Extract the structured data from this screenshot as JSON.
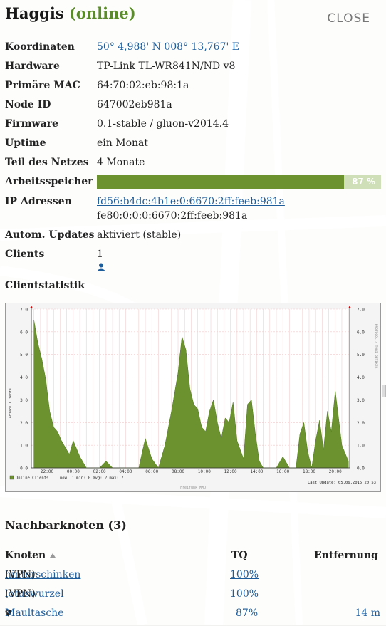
{
  "node": {
    "name": "Haggis",
    "status": "(online)"
  },
  "close_label": "CLOSE",
  "info": {
    "coords_label": "Koordinaten",
    "coords_value": "50° 4,988' N 008° 13,767' E",
    "hardware_label": "Hardware",
    "hardware_value": "TP-Link TL-WR841N/ND v8",
    "mac_label": "Primäre MAC",
    "mac_value": "64:70:02:eb:98:1a",
    "nodeid_label": "Node ID",
    "nodeid_value": "647002eb981a",
    "firmware_label": "Firmware",
    "firmware_value": "0.1-stable / gluon-v2014.4",
    "uptime_label": "Uptime",
    "uptime_value": "ein Monat",
    "network_label": "Teil des Netzes",
    "network_value": "4 Monate",
    "memory_label": "Arbeitsspeicher",
    "memory_percent": 87,
    "memory_text": "87 %",
    "ip_label": "IP Adressen",
    "ip_1": "fd56:b4dc:4b1e:0:6670:2ff:feeb:981a",
    "ip_2": "fe80:0:0:0:6670:2ff:feeb:981a",
    "autoupdate_label": "Autom. Updates",
    "autoupdate_value": "aktiviert (stable)",
    "clients_label": "Clients",
    "clients_value": "1",
    "clientstats_label": "Clientstatistik"
  },
  "chart_data": {
    "type": "area",
    "xlabel": "",
    "ylabel": "Anzahl Clients",
    "y2label": "PROTOCOL / TOBI OETIKER",
    "ylim": [
      0,
      7
    ],
    "yticks": [
      "0.0",
      "1.0",
      "2.0",
      "3.0",
      "4.0",
      "5.0",
      "6.0",
      "7.0"
    ],
    "xticks": [
      "22:00",
      "00:00",
      "02:00",
      "04:00",
      "06:00",
      "08:00",
      "10:00",
      "12:00",
      "14:00",
      "16:00",
      "18:00",
      "20:00"
    ],
    "series_name": "Online Clients",
    "legend_stats": "now:    1   min:    0   avg:    2   max:    7",
    "last_update": "Last Update:  05.06.2015 20:53",
    "footer": "Freifunk MMU",
    "color": "#6b922e",
    "x": [
      21.0,
      21.3,
      21.6,
      21.9,
      22.2,
      22.5,
      22.8,
      23.1,
      23.4,
      23.7,
      24.0,
      24.5,
      25.0,
      25.5,
      26.0,
      26.5,
      27.0,
      27.5,
      28.0,
      28.5,
      29.0,
      29.5,
      30.0,
      30.5,
      31.0,
      31.5,
      32.0,
      32.3,
      32.6,
      32.9,
      33.2,
      33.5,
      33.8,
      34.1,
      34.4,
      34.7,
      35.0,
      35.3,
      35.6,
      35.9,
      36.2,
      36.5,
      37.0,
      37.3,
      37.6,
      37.9,
      38.2,
      38.5,
      39.0,
      39.5,
      40.0,
      40.5,
      41.0,
      41.3,
      41.6,
      41.9,
      42.2,
      42.5,
      42.8,
      43.1,
      43.4,
      43.7,
      44.0,
      44.5,
      45.0
    ],
    "values": [
      6.5,
      5.5,
      4.8,
      3.9,
      2.5,
      1.8,
      1.6,
      1.2,
      0.9,
      0.6,
      1.2,
      0.5,
      0,
      0,
      0,
      0.3,
      0,
      0,
      0,
      0,
      0,
      1.3,
      0.4,
      0,
      1.0,
      2.5,
      4.2,
      5.8,
      5.2,
      3.5,
      2.8,
      2.6,
      1.8,
      1.6,
      2.5,
      3.0,
      2.0,
      1.3,
      2.2,
      2.0,
      2.9,
      1.2,
      0.4,
      2.8,
      3.0,
      1.5,
      0.3,
      0,
      0,
      0,
      0.5,
      0,
      0,
      1.5,
      2.0,
      0.7,
      0,
      1.2,
      2.1,
      0.8,
      2.5,
      1.6,
      3.4,
      1.0,
      0.3
    ]
  },
  "neighbours": {
    "title": "Nachbarknoten (3)",
    "col_node": "Knoten",
    "col_tq": "TQ",
    "col_dist": "Entfernung",
    "rows": [
      {
        "name": "hinterschinken",
        "suffix": "(VPN)",
        "tq": "100%",
        "dist": ""
      },
      {
        "name": "lotuswurzel",
        "suffix": "(VPN)",
        "tq": "100%",
        "dist": ""
      },
      {
        "name": "Maultasche",
        "suffix": "",
        "tq": "87%",
        "dist": "14 m"
      }
    ]
  }
}
